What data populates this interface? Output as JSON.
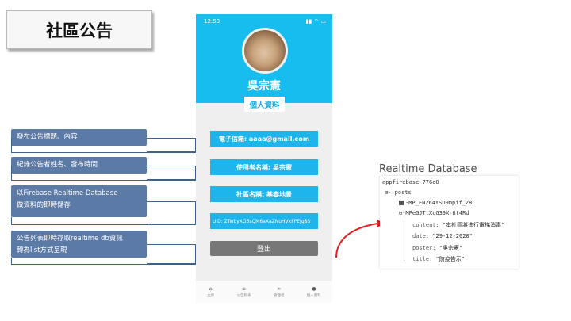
{
  "slide": {
    "title": "社區公告"
  },
  "notes": [
    "發布公告標題、內容",
    "紀錄公告者姓名、發布時間",
    "以Firebase Realtime Database\n做資料的即時儲存",
    "公告列表即時存取realtime db資訊\n轉為list方式呈現"
  ],
  "phone": {
    "time": "12:53",
    "status_icons": "▮▮ ⌔ ▭",
    "user_name": "吳宗憲",
    "tab_label": "個人資料",
    "fields": {
      "email": "電子信箱: aaaa@gmail.com",
      "username": "使用者名稱: 吳宗憲",
      "community": "社區名稱: 基泰地景",
      "uid": "UID: ZTwbyXG6sQM6aXaZNuHVxFPEJg83"
    },
    "logout_label": "登出",
    "nav": [
      {
        "icon": "home-icon",
        "label": "主頁"
      },
      {
        "icon": "list-icon",
        "label": "公告列表"
      },
      {
        "icon": "manage-icon",
        "label": "管理者"
      },
      {
        "icon": "profile-icon",
        "label": "個人資料"
      }
    ],
    "accent_color": "#18bdf0"
  },
  "database": {
    "title": "Realtime Database",
    "app": "appfirebase-776d0",
    "posts_label": "posts",
    "entries": [
      "-MP_FN264YSO9mpif_Z8",
      "-MPeGJTtXcG39Xr8t4Rd"
    ],
    "fields": [
      {
        "key": "content:",
        "value": "\"本社區將進行電梯消毒\""
      },
      {
        "key": "date:",
        "value": "\"29-12-2020\""
      },
      {
        "key": "poster:",
        "value": "\"吳宗憲\""
      },
      {
        "key": "title:",
        "value": "\"防疫告示\""
      }
    ]
  }
}
